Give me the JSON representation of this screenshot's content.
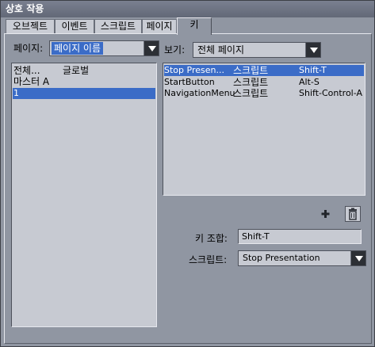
{
  "window": {
    "title": "상호 작용"
  },
  "tabs": [
    {
      "label": "오브젝트"
    },
    {
      "label": "이벤트"
    },
    {
      "label": "스크립트"
    },
    {
      "label": "페이지"
    },
    {
      "label": "키"
    }
  ],
  "page_filter": {
    "label": "페이지:",
    "value": "페이지 이름"
  },
  "view_filter": {
    "label": "보기:",
    "value": "전체 페이지"
  },
  "page_list": [
    {
      "col1": "전체...",
      "col2": "글로벌"
    },
    {
      "col1": "마스터 A",
      "col2": ""
    },
    {
      "col1": "1",
      "col2": "",
      "selected": true
    }
  ],
  "key_list": [
    {
      "name": "Stop Presen...",
      "type": "스크립트",
      "key": "Shift-T",
      "selected": true
    },
    {
      "name": "StartButton",
      "type": "스크립트",
      "key": "Alt-S"
    },
    {
      "name": "NavigationMenu",
      "type": "스크립트",
      "key": "Shift-Control-A"
    }
  ],
  "toolbar": {
    "add_icon": "plus-icon",
    "delete_icon": "trash-icon"
  },
  "key_combo": {
    "label": "키 조합:",
    "value": "Shift-T"
  },
  "script": {
    "label": "스크립트:",
    "value": "Stop Presentation"
  }
}
